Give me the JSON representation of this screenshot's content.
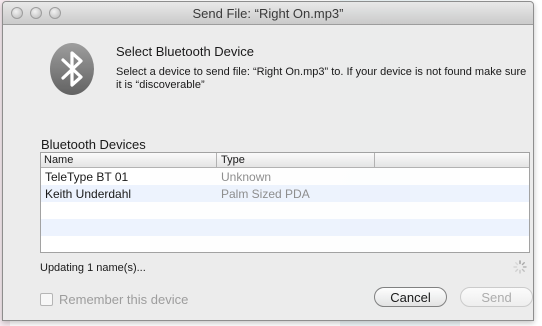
{
  "window": {
    "title": "Send File: “Right On.mp3”"
  },
  "header": {
    "title": "Select Bluetooth Device",
    "description": "Select a device to send file: “Right On.mp3” to.  If your device is not found make sure it is “discoverable”"
  },
  "devices": {
    "label": "Bluetooth Devices",
    "columns": [
      "Name",
      "Type"
    ],
    "rows": [
      {
        "name": "TeleType BT 01",
        "type": "Unknown"
      },
      {
        "name": "Keith Underdahl",
        "type": "Palm Sized PDA"
      }
    ]
  },
  "status": {
    "text": "Updating 1 name(s)..."
  },
  "options": {
    "remember_label": "Remember this device",
    "remember_checked": false
  },
  "buttons": {
    "cancel": "Cancel",
    "send": "Send"
  }
}
